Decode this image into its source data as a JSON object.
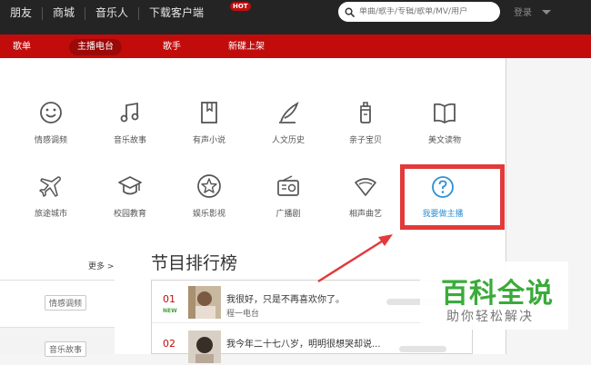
{
  "topnav": {
    "items": [
      "朋友",
      "商城",
      "音乐人",
      "下载客户端"
    ],
    "hot_badge": "HOT"
  },
  "search": {
    "placeholder": "单曲/歌手/专辑/歌单/MV/用户"
  },
  "login": {
    "label": "登录"
  },
  "subnav": {
    "items": [
      "歌单",
      "主播电台",
      "歌手",
      "新碟上架"
    ],
    "active": "主播电台"
  },
  "categories": [
    {
      "label": "情感调频",
      "icon": "smile-icon"
    },
    {
      "label": "音乐故事",
      "icon": "music-note-icon"
    },
    {
      "label": "有声小说",
      "icon": "book-icon"
    },
    {
      "label": "人文历史",
      "icon": "quill-icon"
    },
    {
      "label": "亲子宝贝",
      "icon": "baby-bottle-icon"
    },
    {
      "label": "美文读物",
      "icon": "open-book-icon"
    },
    {
      "label": "旅途城市",
      "icon": "airplane-icon"
    },
    {
      "label": "校园教育",
      "icon": "graduation-cap-icon"
    },
    {
      "label": "娱乐影视",
      "icon": "star-icon"
    },
    {
      "label": "广播剧",
      "icon": "radio-icon"
    },
    {
      "label": "相声曲艺",
      "icon": "fan-icon"
    },
    {
      "label": "我要做主播",
      "icon": "question-icon"
    }
  ],
  "sidebar": {
    "more": "更多 >",
    "tags": [
      "情感调频",
      "音乐故事"
    ]
  },
  "ranking": {
    "title": "节目排行榜",
    "rows": [
      {
        "rank": "01",
        "badge": "NEW",
        "title": "我很好，只是不再喜欢你了。",
        "artist": "程一电台"
      },
      {
        "rank": "02",
        "badge": "",
        "title": "我今年二十七八岁，明明很想哭却说...",
        "artist": ""
      }
    ]
  },
  "watermark": {
    "title": "百科全说",
    "subtitle": "助你轻松解决"
  },
  "colors": {
    "accent": "#c20c0c",
    "topbar": "#242424",
    "highlight_box": "#e23a3a",
    "link_blue": "#2a8fd6",
    "watermark_green": "#3aab3a"
  }
}
